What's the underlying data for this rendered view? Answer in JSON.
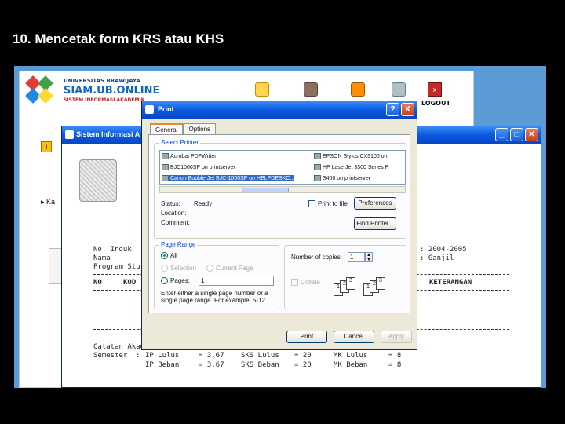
{
  "slide": {
    "title": "10. Mencetak form KRS atau KHS"
  },
  "siam": {
    "brand_line1": "UNIVERSITAS BRAWIJAYA",
    "brand_line2": "SIAM.UB.ONLINE",
    "brand_line3": "SISTEM INFORMASI AKADEMIK",
    "logout_label": "LOGOUT",
    "side_arrow": "▸ Ka"
  },
  "sis_window": {
    "title": "Sistem Informasi A",
    "header": {
      "no_induk": "No. Induk",
      "nama": "Nama",
      "program_studi": "Program Stu",
      "tahun": ": 2004-2005",
      "semester": ": Ganjil"
    },
    "table_headers": {
      "no": "NO",
      "kode": "KOD",
      "keterangan": "KETERANGAN"
    },
    "catatan": "Catatan Akademik :",
    "summary_rows": [
      {
        "label": "Semester",
        "sep": ":",
        "ip_key": "IP Lulus",
        "ip_val": "= 3.67",
        "sks_key": "SKS Lulus",
        "sks_val": "= 20",
        "mk_key": "MK Lulus",
        "mk_val": "= 8"
      },
      {
        "label": "",
        "sep": "",
        "ip_key": "IP Beban",
        "ip_val": "= 3.67",
        "sks_key": "SKS Beban",
        "sks_val": "= 20",
        "mk_key": "MK Beban",
        "mk_val": "= 8"
      }
    ]
  },
  "print_dialog": {
    "title": "Print",
    "tabs": [
      {
        "label": "General"
      },
      {
        "label": "Options"
      }
    ],
    "select_printer_label": "Select Printer",
    "printers": [
      {
        "name": "Acrobat PDFWriter",
        "selected": false
      },
      {
        "name": "EPSON Stylus CX3100 on",
        "selected": false
      },
      {
        "name": "BJC1000SP on printserver",
        "selected": false
      },
      {
        "name": "HP LaserJet 3300 Series P",
        "selected": false
      },
      {
        "name": "Canon Bubble-Jet BJC-1000SP on HELPDESKC...",
        "selected": true
      },
      {
        "name": "S400 on printserver",
        "selected": false
      }
    ],
    "status_label": "Status:",
    "status_value": "Ready",
    "location_label": "Location:",
    "comment_label": "Comment:",
    "print_to_file": "Print to file",
    "preferences_button": "Preferences",
    "find_printer_button": "Find Printer...",
    "page_range_label": "Page Range",
    "range_all": "All",
    "range_selection": "Selection",
    "range_current": "Current Page",
    "range_pages": "Pages:",
    "pages_value": "1",
    "pages_hint": "Enter either a single page number or a single page range. For example, 5-12",
    "copies_label": "Number of copies:",
    "copies_value": "1",
    "collate_label": "Collate",
    "print_button": "Print",
    "cancel_button": "Cancel",
    "apply_button": "Apply",
    "help_button": "?",
    "close_button": "X"
  },
  "colors": {
    "xp_title_blue": "#0a5ae0",
    "dialog_face": "#ece9d8",
    "selection": "#316ac5",
    "group_label": "#0046d5",
    "slide_bg": "#000000",
    "desktop": "#5b9bd5"
  }
}
